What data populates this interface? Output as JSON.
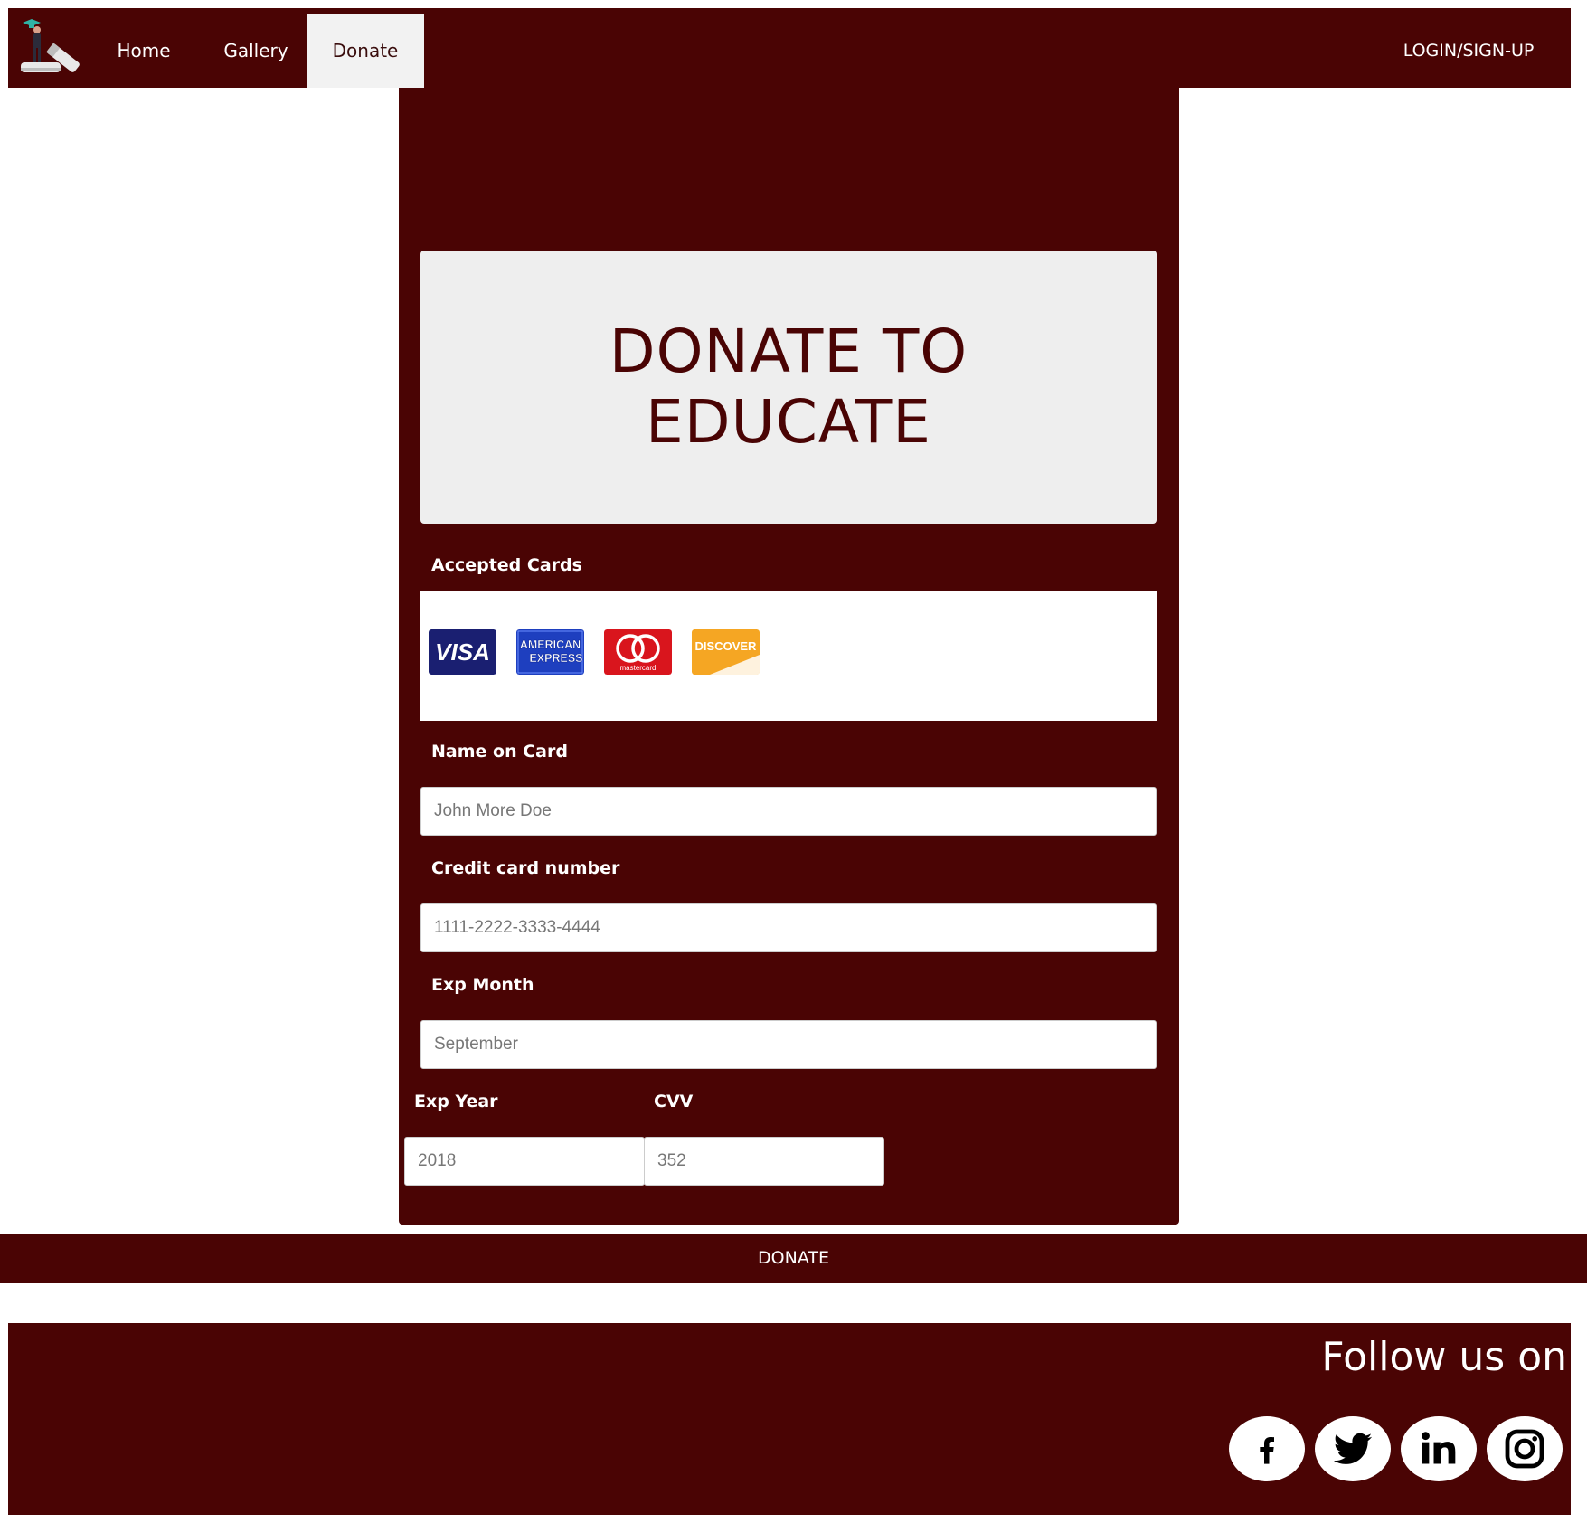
{
  "nav": {
    "home": "Home",
    "gallery": "Gallery",
    "donate": "Donate",
    "login": "LOGIN/SIGN-UP"
  },
  "hero": {
    "title_line1": "DONATE TO",
    "title_line2": "EDUCATE"
  },
  "form": {
    "accepted_cards_label": "Accepted Cards",
    "cards": [
      {
        "name": "visa-icon",
        "text": "VISA"
      },
      {
        "name": "american-express-icon",
        "text": "AMERICAN EXPRESS"
      },
      {
        "name": "mastercard-icon",
        "text": "mastercard"
      },
      {
        "name": "discover-icon",
        "text": "DISCOVER"
      }
    ],
    "name_label": "Name on Card",
    "name_placeholder": "John More Doe",
    "card_number_label": "Credit card number",
    "card_number_placeholder": "1111-2222-3333-4444",
    "exp_month_label": "Exp Month",
    "exp_month_placeholder": "September",
    "exp_year_label": "Exp Year",
    "exp_year_placeholder": "2018",
    "cvv_label": "CVV",
    "cvv_placeholder": "352"
  },
  "donate_button": "DONATE",
  "footer": {
    "follow_text": "Follow us on",
    "social": [
      "facebook-icon",
      "twitter-icon",
      "linkedin-icon",
      "instagram-icon"
    ]
  },
  "colors": {
    "brand": "#4a0404",
    "hero_bg": "#eeeeee",
    "active_tab_bg": "#f2f2f2"
  }
}
